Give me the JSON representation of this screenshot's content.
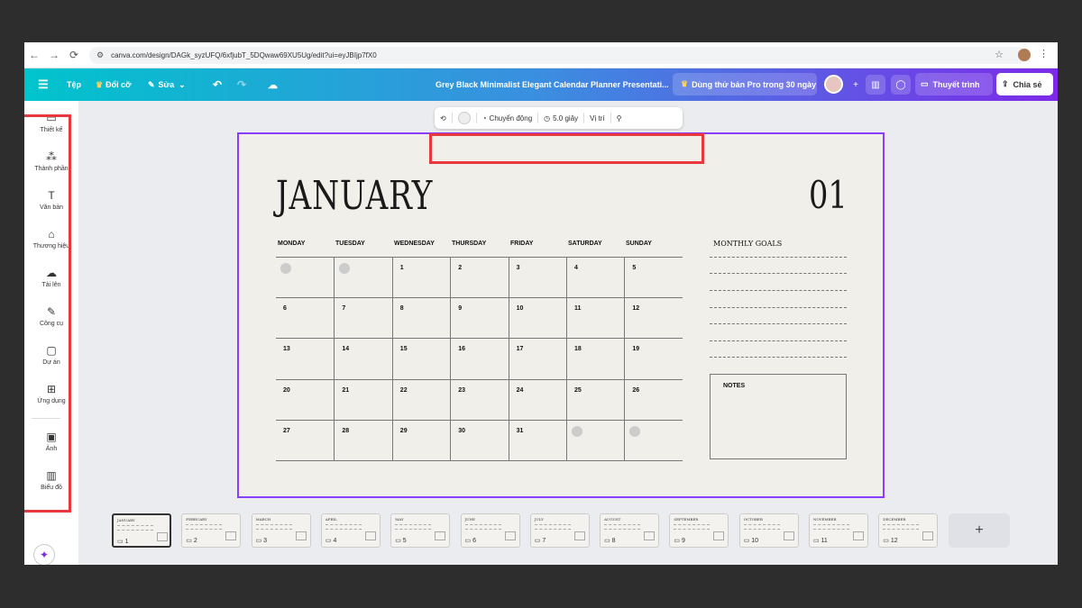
{
  "browser": {
    "url": "canva.com/design/DAGk_syzUFQ/6xfjubT_5DQwaw69XU5Ug/edit?ui=eyJBIjp7fX0"
  },
  "header": {
    "file": "Tệp",
    "resize": "Đổi cỡ",
    "edit": "Sửa",
    "title": "Grey Black Minimalist Elegant Calendar Planner Presentati...",
    "pro_trial": "Dùng thử bản Pro trong 30 ngày",
    "present": "Thuyết trình",
    "share": "Chia sẻ"
  },
  "sidebar": {
    "items": [
      {
        "label": "Thiết kế",
        "icon": "design-icon"
      },
      {
        "label": "Thành phần",
        "icon": "elements-icon"
      },
      {
        "label": "Văn bản",
        "icon": "text-icon"
      },
      {
        "label": "Thương hiệu",
        "icon": "brand-icon"
      },
      {
        "label": "Tải lên",
        "icon": "upload-icon"
      },
      {
        "label": "Công cụ",
        "icon": "tools-icon"
      },
      {
        "label": "Dự án",
        "icon": "projects-icon"
      },
      {
        "label": "Ứng dụng",
        "icon": "apps-icon"
      },
      {
        "label": "Ảnh",
        "icon": "photo-icon"
      },
      {
        "label": "Biểu đồ",
        "icon": "chart-icon"
      }
    ]
  },
  "page_toolbar": {
    "animate": "Chuyển động",
    "duration": "5.0 giây",
    "position": "Vị trí"
  },
  "calendar": {
    "month": "JANUARY",
    "month_number": "01",
    "weekdays": [
      "MONDAY",
      "TUESDAY",
      "WEDNESDAY",
      "THURSDAY",
      "FRIDAY",
      "SATURDAY",
      "SUNDAY"
    ],
    "weeks": [
      [
        "",
        "",
        "1",
        "2",
        "3",
        "4",
        "5"
      ],
      [
        "6",
        "7",
        "8",
        "9",
        "10",
        "11",
        "12"
      ],
      [
        "13",
        "14",
        "15",
        "16",
        "17",
        "18",
        "19"
      ],
      [
        "20",
        "21",
        "22",
        "23",
        "24",
        "25",
        "26"
      ],
      [
        "27",
        "28",
        "29",
        "30",
        "31",
        "",
        ""
      ]
    ],
    "goals_title": "MONTHLY GOALS",
    "notes_title": "NOTES"
  },
  "pages": [
    {
      "num": "1",
      "month": "JANUARY"
    },
    {
      "num": "2",
      "month": "FEBRUARY"
    },
    {
      "num": "3",
      "month": "MARCH"
    },
    {
      "num": "4",
      "month": "APRIL"
    },
    {
      "num": "5",
      "month": "MAY"
    },
    {
      "num": "6",
      "month": "JUNE"
    },
    {
      "num": "7",
      "month": "JULY"
    },
    {
      "num": "8",
      "month": "AUGUST"
    },
    {
      "num": "9",
      "month": "SEPTEMBER"
    },
    {
      "num": "10",
      "month": "OCTOBER"
    },
    {
      "num": "11",
      "month": "NOVEMBER"
    },
    {
      "num": "12",
      "month": "DECEMBER"
    }
  ],
  "add_page": "+",
  "colors": {
    "highlight": "#e8383d",
    "selection": "#8b3dff",
    "canvas": "#f0efe9"
  }
}
